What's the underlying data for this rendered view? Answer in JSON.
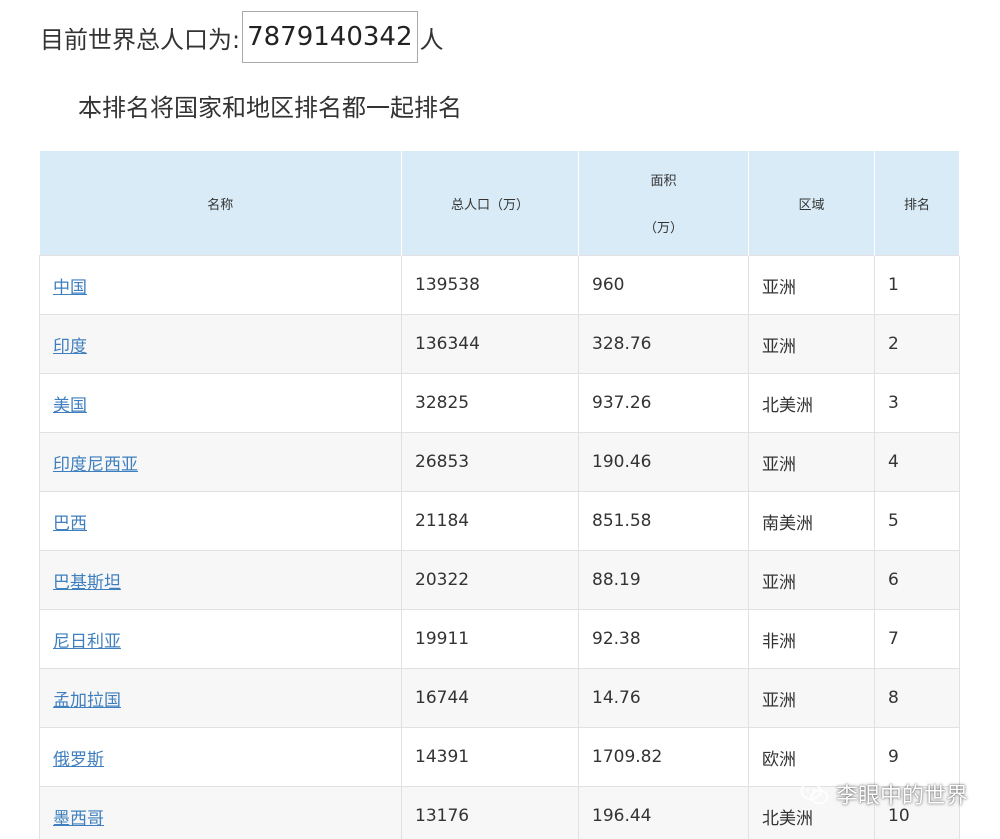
{
  "header": {
    "population_label": "目前世界总人口为:",
    "population_value": "7879140342",
    "population_unit": "人",
    "note": "本排名将国家和地区排名都一起排名"
  },
  "table": {
    "columns": [
      {
        "line1": "名称",
        "line2": ""
      },
      {
        "line1": "总人口（万）",
        "line2": ""
      },
      {
        "line1": "面积",
        "line2": "（万）"
      },
      {
        "line1": "区域",
        "line2": ""
      },
      {
        "line1": "排名",
        "line2": ""
      }
    ],
    "rows": [
      {
        "name": "中国",
        "population": "139538",
        "area": "960",
        "region": "亚洲",
        "rank": "1"
      },
      {
        "name": "印度",
        "population": "136344",
        "area": "328.76",
        "region": "亚洲",
        "rank": "2"
      },
      {
        "name": "美国",
        "population": "32825",
        "area": "937.26",
        "region": "北美洲",
        "rank": "3"
      },
      {
        "name": "印度尼西亚",
        "population": "26853",
        "area": "190.46",
        "region": "亚洲",
        "rank": "4"
      },
      {
        "name": "巴西",
        "population": "21184",
        "area": "851.58",
        "region": "南美洲",
        "rank": "5"
      },
      {
        "name": "巴基斯坦",
        "population": "20322",
        "area": "88.19",
        "region": "亚洲",
        "rank": "6"
      },
      {
        "name": "尼日利亚",
        "population": "19911",
        "area": "92.38",
        "region": "非洲",
        "rank": "7"
      },
      {
        "name": "孟加拉国",
        "population": "16744",
        "area": "14.76",
        "region": "亚洲",
        "rank": "8"
      },
      {
        "name": "俄罗斯",
        "population": "14391",
        "area": "1709.82",
        "region": "欧洲",
        "rank": "9"
      },
      {
        "name": "墨西哥",
        "population": "13176",
        "area": "196.44",
        "region": "北美洲",
        "rank": "10"
      }
    ]
  },
  "watermark": {
    "icon": "wechat-icon",
    "text": "李眼中的世界"
  },
  "colors": {
    "header_bg": "#d9ebf6",
    "link": "#3f7fbf",
    "row_alt": "#f7f7f7",
    "border": "#e1e1e1"
  }
}
